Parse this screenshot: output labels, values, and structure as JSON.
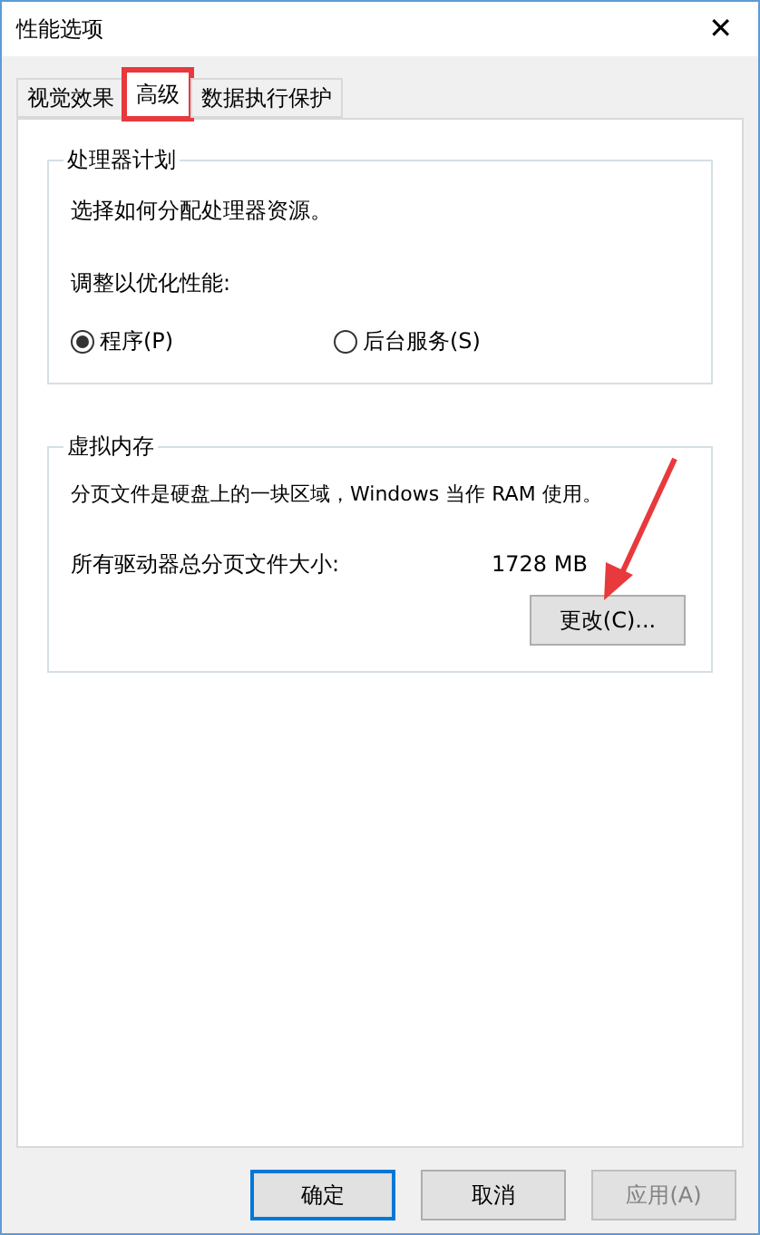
{
  "window": {
    "title": "性能选项",
    "close": "✕"
  },
  "tabs": [
    {
      "label": "视觉效果",
      "selected": false,
      "highlighted": false
    },
    {
      "label": "高级",
      "selected": true,
      "highlighted": true
    },
    {
      "label": "数据执行保护",
      "selected": false,
      "highlighted": false
    }
  ],
  "processor": {
    "title": "处理器计划",
    "description": "选择如何分配处理器资源。",
    "prompt": "调整以优化性能:",
    "options": [
      {
        "label": "程序(P)",
        "selected": true
      },
      {
        "label": "后台服务(S)",
        "selected": false
      }
    ]
  },
  "virtual_memory": {
    "title": "虚拟内存",
    "description": "分页文件是硬盘上的一块区域，Windows 当作 RAM 使用。",
    "size_label": "所有驱动器总分页文件大小:",
    "size_value": "1728 MB",
    "button": "更改(C)...",
    "arrow": true
  },
  "buttons": [
    {
      "label": "确定",
      "default": true,
      "disabled": false
    },
    {
      "label": "取消",
      "default": false,
      "disabled": false
    },
    {
      "label": "应用(A)",
      "default": false,
      "disabled": true
    }
  ]
}
